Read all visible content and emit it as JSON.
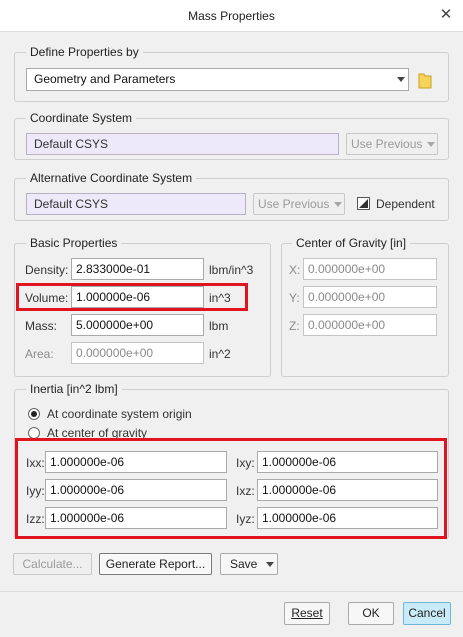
{
  "window": {
    "title": "Mass Properties",
    "close_glyph": "✕"
  },
  "define": {
    "legend": "Define Properties by",
    "value": "Geometry and Parameters"
  },
  "coord": {
    "legend": "Coordinate System",
    "value": "Default CSYS",
    "use_previous": "Use Previous"
  },
  "alt": {
    "legend": "Alternative Coordinate System",
    "value": "Default CSYS",
    "use_previous": "Use Previous",
    "dependent": "Dependent"
  },
  "basic": {
    "legend": "Basic Properties",
    "density": {
      "label": "Density:",
      "value": "2.833000e-01",
      "unit": "lbm/in^3"
    },
    "volume": {
      "label": "Volume:",
      "value": "1.000000e-06",
      "unit": "in^3"
    },
    "mass": {
      "label": "Mass:",
      "value": "5.000000e+00",
      "unit": "lbm"
    },
    "area": {
      "label": "Area:",
      "value": "0.000000e+00",
      "unit": "in^2"
    }
  },
  "cog": {
    "legend": "Center of Gravity [in]",
    "x": {
      "label": "X:",
      "value": "0.000000e+00"
    },
    "y": {
      "label": "Y:",
      "value": "0.000000e+00"
    },
    "z": {
      "label": "Z:",
      "value": "0.000000e+00"
    }
  },
  "inertia": {
    "legend": "Inertia [in^2 lbm]",
    "radio_origin": "At coordinate system origin",
    "radio_cog": "At center of gravity",
    "selected": "origin",
    "ixx": {
      "label": "Ixx:",
      "value": "1.000000e-06"
    },
    "iyy": {
      "label": "Iyy:",
      "value": "1.000000e-06"
    },
    "izz": {
      "label": "Izz:",
      "value": "1.000000e-06"
    },
    "ixy": {
      "label": "Ixy:",
      "value": "1.000000e-06"
    },
    "ixz": {
      "label": "Ixz:",
      "value": "1.000000e-06"
    },
    "iyz": {
      "label": "Iyz:",
      "value": "1.000000e-06"
    }
  },
  "actions": {
    "calculate": "Calculate...",
    "generate_report": "Generate Report...",
    "save": "Save"
  },
  "footer": {
    "reset": "Reset",
    "ok": "OK",
    "cancel": "Cancel"
  },
  "colors": {
    "highlight": "#e0141e",
    "cancel_bg": "#c9ebf7",
    "folder": "#f7d35a"
  }
}
